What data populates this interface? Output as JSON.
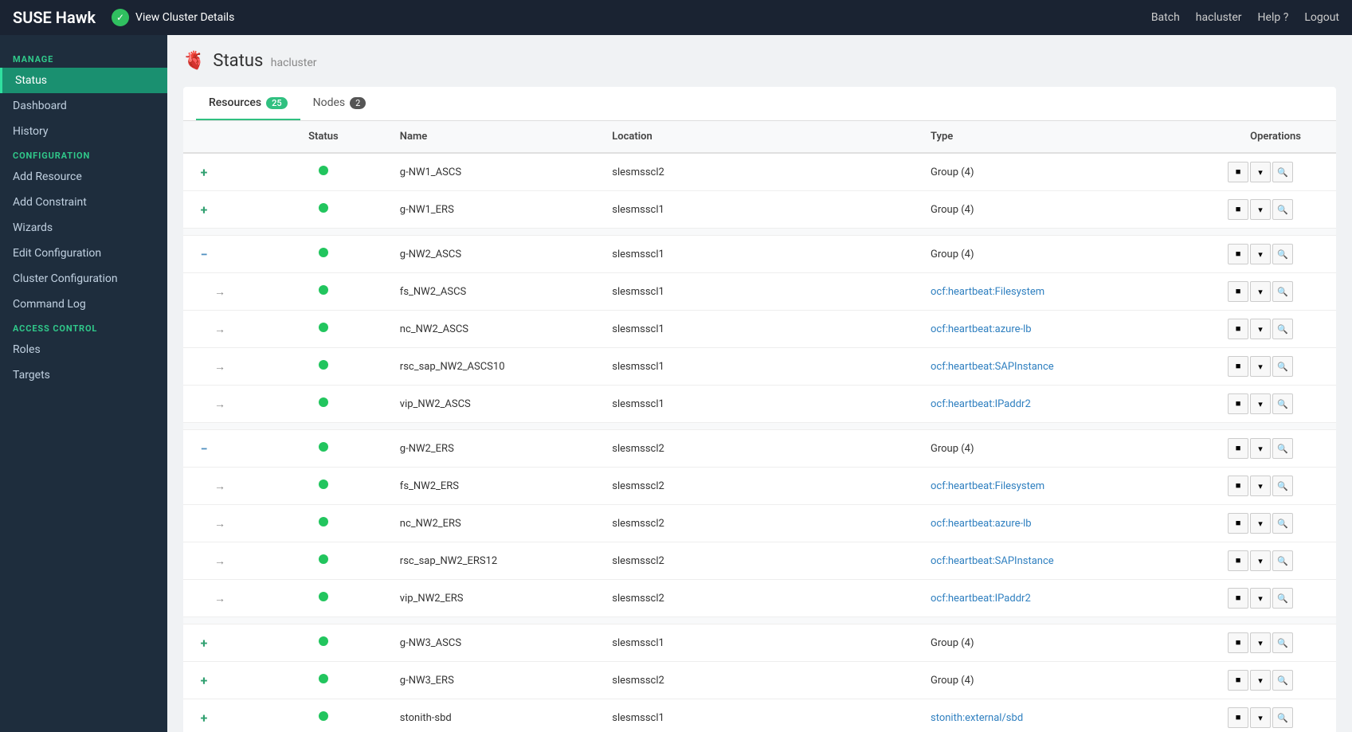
{
  "app": {
    "brand": "SUSE Hawk",
    "navbar": {
      "cluster_details": "View Cluster Details",
      "batch": "Batch",
      "cluster_user": "hacluster",
      "help": "Help ?",
      "logout": "Logout"
    }
  },
  "sidebar": {
    "manage_label": "MANAGE",
    "manage_items": [
      {
        "id": "status",
        "label": "Status",
        "active": true
      },
      {
        "id": "dashboard",
        "label": "Dashboard",
        "active": false
      },
      {
        "id": "history",
        "label": "History",
        "active": false
      }
    ],
    "config_label": "CONFIGURATION",
    "config_items": [
      {
        "id": "add-resource",
        "label": "Add Resource",
        "active": false
      },
      {
        "id": "add-constraint",
        "label": "Add Constraint",
        "active": false
      },
      {
        "id": "wizards",
        "label": "Wizards",
        "active": false
      },
      {
        "id": "edit-configuration",
        "label": "Edit Configuration",
        "active": false
      },
      {
        "id": "cluster-configuration",
        "label": "Cluster Configuration",
        "active": false
      },
      {
        "id": "command-log",
        "label": "Command Log",
        "active": false
      }
    ],
    "access_label": "ACCESS CONTROL",
    "access_items": [
      {
        "id": "roles",
        "label": "Roles",
        "active": false
      },
      {
        "id": "targets",
        "label": "Targets",
        "active": false
      }
    ]
  },
  "page": {
    "title": "Status",
    "cluster_name": "hacluster"
  },
  "tabs": [
    {
      "id": "resources",
      "label": "Resources",
      "badge": "25",
      "active": true
    },
    {
      "id": "nodes",
      "label": "Nodes",
      "badge": "2",
      "active": false
    }
  ],
  "table": {
    "headers": [
      "",
      "Status",
      "Name",
      "Location",
      "Type",
      "Operations"
    ],
    "rows": [
      {
        "id": "g-NW1_ASCS",
        "expand": "+",
        "expand_type": "plus",
        "status": "green",
        "name": "g-NW1_ASCS",
        "location": "slesmsscl2",
        "type": "Group (4)",
        "type_link": false
      },
      {
        "id": "g-NW1_ERS",
        "expand": "+",
        "expand_type": "plus",
        "status": "green",
        "name": "g-NW1_ERS",
        "location": "slesmsscl1",
        "type": "Group (4)",
        "type_link": false
      },
      {
        "id": "sep1",
        "separator": true
      },
      {
        "id": "g-NW2_ASCS",
        "expand": "−",
        "expand_type": "minus",
        "status": "green",
        "name": "g-NW2_ASCS",
        "location": "slesmsscl1",
        "type": "Group (4)",
        "type_link": false
      },
      {
        "id": "fs_NW2_ASCS",
        "expand": "→",
        "expand_type": "arrow",
        "status": "green",
        "name": "fs_NW2_ASCS",
        "location": "slesmsscl1",
        "type": "ocf:heartbeat:Filesystem",
        "type_link": true,
        "indent": true
      },
      {
        "id": "nc_NW2_ASCS",
        "expand": "→",
        "expand_type": "arrow",
        "status": "green",
        "name": "nc_NW2_ASCS",
        "location": "slesmsscl1",
        "type": "ocf:heartbeat:azure-lb",
        "type_link": true,
        "indent": true
      },
      {
        "id": "rsc_sap_NW2_ASCS10",
        "expand": "→",
        "expand_type": "arrow",
        "status": "green",
        "name": "rsc_sap_NW2_ASCS10",
        "location": "slesmsscl1",
        "type": "ocf:heartbeat:SAPInstance",
        "type_link": true,
        "indent": true
      },
      {
        "id": "vip_NW2_ASCS",
        "expand": "→",
        "expand_type": "arrow",
        "status": "green",
        "name": "vip_NW2_ASCS",
        "location": "slesmsscl1",
        "type": "ocf:heartbeat:IPaddr2",
        "type_link": true,
        "indent": true
      },
      {
        "id": "sep2",
        "separator": true
      },
      {
        "id": "g-NW2_ERS",
        "expand": "−",
        "expand_type": "minus",
        "status": "green",
        "name": "g-NW2_ERS",
        "location": "slesmsscl2",
        "type": "Group (4)",
        "type_link": false
      },
      {
        "id": "fs_NW2_ERS",
        "expand": "→",
        "expand_type": "arrow",
        "status": "green",
        "name": "fs_NW2_ERS",
        "location": "slesmsscl2",
        "type": "ocf:heartbeat:Filesystem",
        "type_link": true,
        "indent": true
      },
      {
        "id": "nc_NW2_ERS",
        "expand": "→",
        "expand_type": "arrow",
        "status": "green",
        "name": "nc_NW2_ERS",
        "location": "slesmsscl2",
        "type": "ocf:heartbeat:azure-lb",
        "type_link": true,
        "indent": true
      },
      {
        "id": "rsc_sap_NW2_ERS12",
        "expand": "→",
        "expand_type": "arrow",
        "status": "green",
        "name": "rsc_sap_NW2_ERS12",
        "location": "slesmsscl2",
        "type": "ocf:heartbeat:SAPInstance",
        "type_link": true,
        "indent": true
      },
      {
        "id": "vip_NW2_ERS",
        "expand": "→",
        "expand_type": "arrow",
        "status": "green",
        "name": "vip_NW2_ERS",
        "location": "slesmsscl2",
        "type": "ocf:heartbeat:IPaddr2",
        "type_link": true,
        "indent": true
      },
      {
        "id": "sep3",
        "separator": true
      },
      {
        "id": "g-NW3_ASCS",
        "expand": "+",
        "expand_type": "plus",
        "status": "green",
        "name": "g-NW3_ASCS",
        "location": "slesmsscl1",
        "type": "Group (4)",
        "type_link": false
      },
      {
        "id": "g-NW3_ERS",
        "expand": "+",
        "expand_type": "plus",
        "status": "green",
        "name": "g-NW3_ERS",
        "location": "slesmsscl2",
        "type": "Group (4)",
        "type_link": false
      },
      {
        "id": "stonith-sbd",
        "expand": "+",
        "expand_type": "plus",
        "status": "green",
        "name": "stonith-sbd",
        "location": "slesmsscl1",
        "type": "stonith:external/sbd",
        "type_link": true
      }
    ]
  }
}
